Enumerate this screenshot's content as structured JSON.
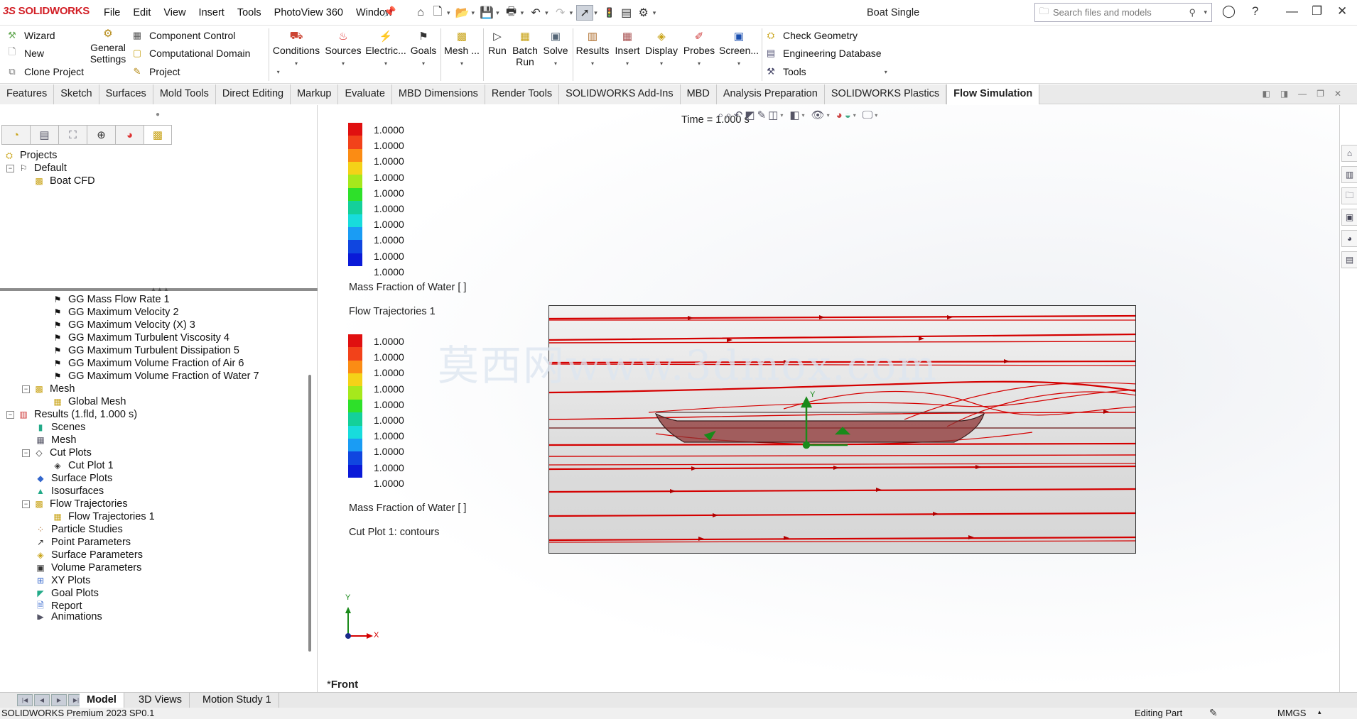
{
  "app": {
    "logo_ds": "3S",
    "logo_text": "SOLIDWORKS",
    "document_title": "Boat Single",
    "menu": [
      "File",
      "Edit",
      "View",
      "Insert",
      "Tools",
      "PhotoView 360",
      "Window"
    ],
    "search_placeholder": "Search files and models"
  },
  "command_manager": {
    "wizard": "Wizard",
    "new": "New",
    "clone_project": "Clone Project",
    "general_settings_1": "General",
    "general_settings_2": "Settings",
    "component_control": "Component Control",
    "computational_domain": "Computational Domain",
    "project": "Project",
    "conditions": "Conditions",
    "sources": "Sources",
    "electric": "Electric...",
    "goals": "Goals",
    "mesh": "Mesh ...",
    "run": "Run",
    "batch_run_1": "Batch",
    "batch_run_2": "Run",
    "solve": "Solve",
    "results": "Results",
    "insert": "Insert",
    "display": "Display",
    "probes": "Probes",
    "screen": "Screen...",
    "check_geometry": "Check Geometry",
    "engineering_database": "Engineering Database",
    "tools": "Tools"
  },
  "tabs": [
    "Features",
    "Sketch",
    "Surfaces",
    "Mold Tools",
    "Direct Editing",
    "Markup",
    "Evaluate",
    "MBD Dimensions",
    "Render Tools",
    "SOLIDWORKS Add-Ins",
    "MBD",
    "Analysis Preparation",
    "SOLIDWORKS Plastics",
    "Flow Simulation"
  ],
  "active_tab": "Flow Simulation",
  "project_tree": {
    "projects": "Projects",
    "default": "Default",
    "boat_cfd": "Boat CFD"
  },
  "analysis_tree": {
    "goals": [
      "GG Mass Flow Rate 1",
      "GG Maximum Velocity 2",
      "GG Maximum Velocity (X) 3",
      "GG Maximum Turbulent Viscosity 4",
      "GG Maximum Turbulent Dissipation 5",
      "GG Maximum Volume Fraction of Air 6",
      "GG Maximum Volume Fraction of Water 7"
    ],
    "mesh": "Mesh",
    "global_mesh": "Global Mesh",
    "results": "Results (1.fld, 1.000 s)",
    "scenes": "Scenes",
    "results_mesh": "Mesh",
    "cut_plots": "Cut Plots",
    "cut_plot_1": "Cut Plot 1",
    "surface_plots": "Surface Plots",
    "isosurfaces": "Isosurfaces",
    "flow_trajectories": "Flow Trajectories",
    "flow_trajectories_1": "Flow Trajectories 1",
    "particle_studies": "Particle Studies",
    "point_parameters": "Point Parameters",
    "surface_parameters": "Surface Parameters",
    "volume_parameters": "Volume Parameters",
    "xy_plots": "XY Plots",
    "goal_plots": "Goal Plots",
    "report": "Report",
    "animations": "Animations"
  },
  "viewport": {
    "time_label": "Time = 1.000 s",
    "legend_values": [
      "1.0000",
      "1.0000",
      "1.0000",
      "1.0000",
      "1.0000",
      "1.0000",
      "1.0000",
      "1.0000",
      "1.0000",
      "1.0000"
    ],
    "legend_colors": [
      "#e01010",
      "#f2421a",
      "#fb8c14",
      "#f4d218",
      "#a6e81c",
      "#2ee02a",
      "#14d09a",
      "#18dcdc",
      "#1a9cf4",
      "#1046e0",
      "#0a1ad8"
    ],
    "legend1_title": "Mass Fraction of Water [ ]",
    "flow_trajectories_label": "Flow Trajectories 1",
    "legend2_title": "Mass Fraction of Water [ ]",
    "cut_plot_label": "Cut Plot 1: contours",
    "watermark": "莫西网www.3dmox.com",
    "axis_y": "Y",
    "axis_x": "X",
    "view_name_prefix": "*",
    "view_name": "Front",
    "trajectory_color": "#d40000",
    "hull_color": "#8a3a3a",
    "axis_green": "#1a8a1a"
  },
  "bottom_tabs": [
    "Model",
    "3D Views",
    "Motion Study 1"
  ],
  "active_bottom_tab": "Model",
  "status_bar": {
    "product": "SOLIDWORKS Premium 2023 SP0.1",
    "mode": "Editing Part",
    "units": "MMGS"
  }
}
